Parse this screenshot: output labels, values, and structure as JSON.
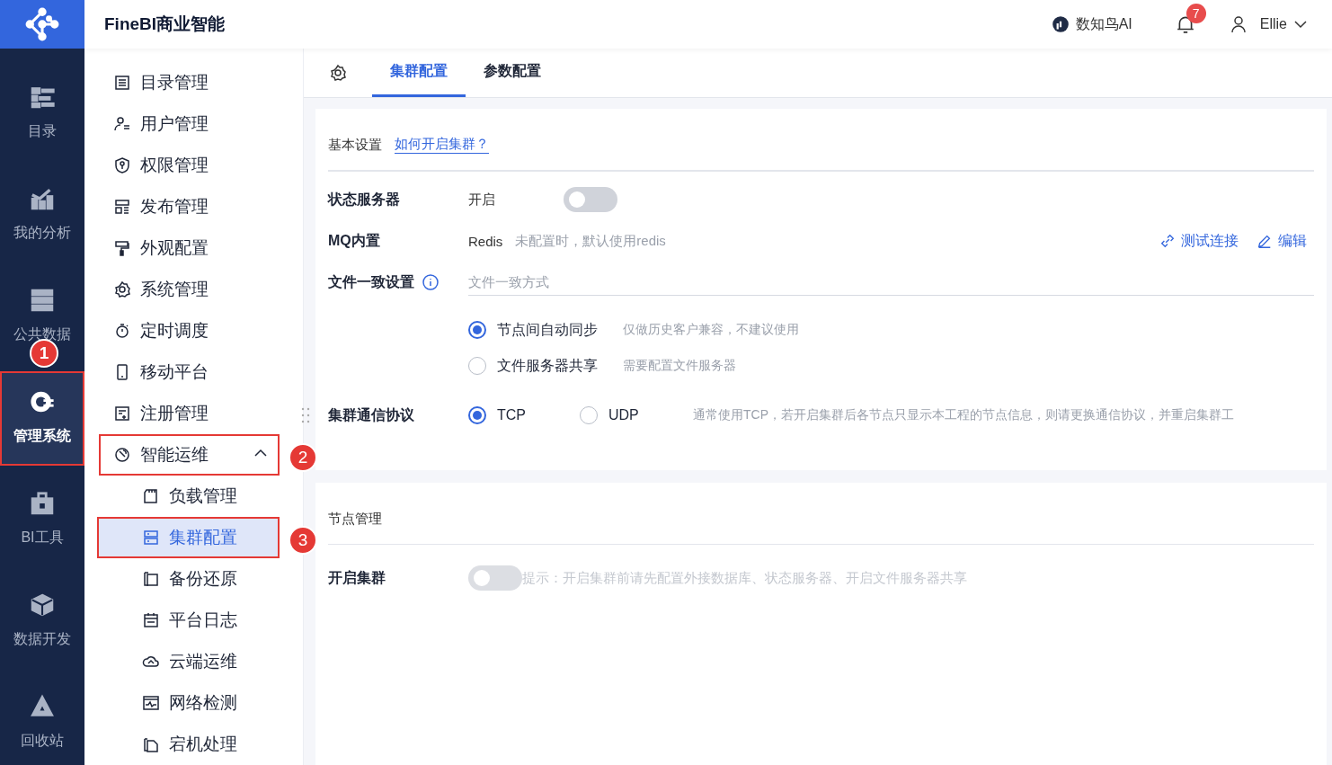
{
  "header": {
    "title": "FineBI商业智能",
    "ai_label": "数知鸟AI",
    "notification_count": "7",
    "user": "Ellie"
  },
  "rail": [
    {
      "label": "目录",
      "selected": false,
      "highlighted": false
    },
    {
      "label": "我的分析",
      "selected": false,
      "highlighted": false
    },
    {
      "label": "公共数据",
      "selected": false,
      "highlighted": false
    },
    {
      "label": "管理系统",
      "selected": true,
      "highlighted": true,
      "callout": "1"
    },
    {
      "label": "BI工具",
      "selected": false,
      "highlighted": false
    },
    {
      "label": "数据开发",
      "selected": false,
      "highlighted": false
    },
    {
      "label": "回收站",
      "selected": false,
      "highlighted": false
    }
  ],
  "sidebar": {
    "items": [
      {
        "label": "目录管理",
        "selected": false,
        "highlighted": false
      },
      {
        "label": "用户管理",
        "selected": false,
        "highlighted": false
      },
      {
        "label": "权限管理",
        "selected": false,
        "highlighted": false
      },
      {
        "label": "发布管理",
        "selected": false,
        "highlighted": false
      },
      {
        "label": "外观配置",
        "selected": false,
        "highlighted": false
      },
      {
        "label": "系统管理",
        "selected": false,
        "highlighted": false
      },
      {
        "label": "定时调度",
        "selected": false,
        "highlighted": false
      },
      {
        "label": "移动平台",
        "selected": false,
        "highlighted": false
      },
      {
        "label": "注册管理",
        "selected": false,
        "highlighted": false
      },
      {
        "label": "智能运维",
        "selected": false,
        "highlighted": true,
        "callout": "2",
        "expanded": true,
        "children": [
          {
            "label": "负载管理",
            "selected": false,
            "highlighted": false
          },
          {
            "label": "集群配置",
            "selected": true,
            "highlighted": true,
            "callout": "3"
          },
          {
            "label": "备份还原",
            "selected": false,
            "highlighted": false
          },
          {
            "label": "平台日志",
            "selected": false,
            "highlighted": false
          },
          {
            "label": "云端运维",
            "selected": false,
            "highlighted": false
          },
          {
            "label": "网络检测",
            "selected": false,
            "highlighted": false
          },
          {
            "label": "宕机处理",
            "selected": false,
            "highlighted": false
          }
        ]
      }
    ]
  },
  "tabs": [
    {
      "label": "集群配置",
      "selected": true
    },
    {
      "label": "参数配置",
      "selected": false
    }
  ],
  "basic_settings": {
    "title": "基本设置",
    "help_link": "如何开启集群？",
    "rows": [
      {
        "kind": "toggle",
        "label": "状态服务器",
        "text": "开启",
        "on": false,
        "disabled": false
      },
      {
        "kind": "value",
        "label": "MQ内置",
        "value": "Redis",
        "hint": "未配置时，默认使用redis",
        "actions": [
          "测试连接",
          "编辑"
        ]
      },
      {
        "kind": "field",
        "label": "文件一致设置",
        "info": true,
        "placeholder": "文件一致方式"
      },
      {
        "kind": "radio_list",
        "options": [
          {
            "label": "节点间自动同步",
            "hint": "仅做历史客户兼容，不建议使用",
            "selected": true
          },
          {
            "label": "文件服务器共享",
            "hint": "需要配置文件服务器",
            "selected": false
          }
        ]
      },
      {
        "kind": "radio_inline",
        "label": "集群通信协议",
        "options": [
          {
            "label": "TCP",
            "selected": true
          },
          {
            "label": "UDP",
            "selected": false
          }
        ],
        "hint": "通常使用TCP，若开启集群后各节点只显示本工程的节点信息，则请更换通信协议，并重启集群工"
      }
    ]
  },
  "node_management": {
    "title": "节点管理",
    "rows": [
      {
        "kind": "toggle",
        "label": "开启集群",
        "on": false,
        "disabled": true,
        "hint": "提示：开启集群前请先配置外接数据库、状态服务器、开启文件服务器共享"
      }
    ]
  }
}
